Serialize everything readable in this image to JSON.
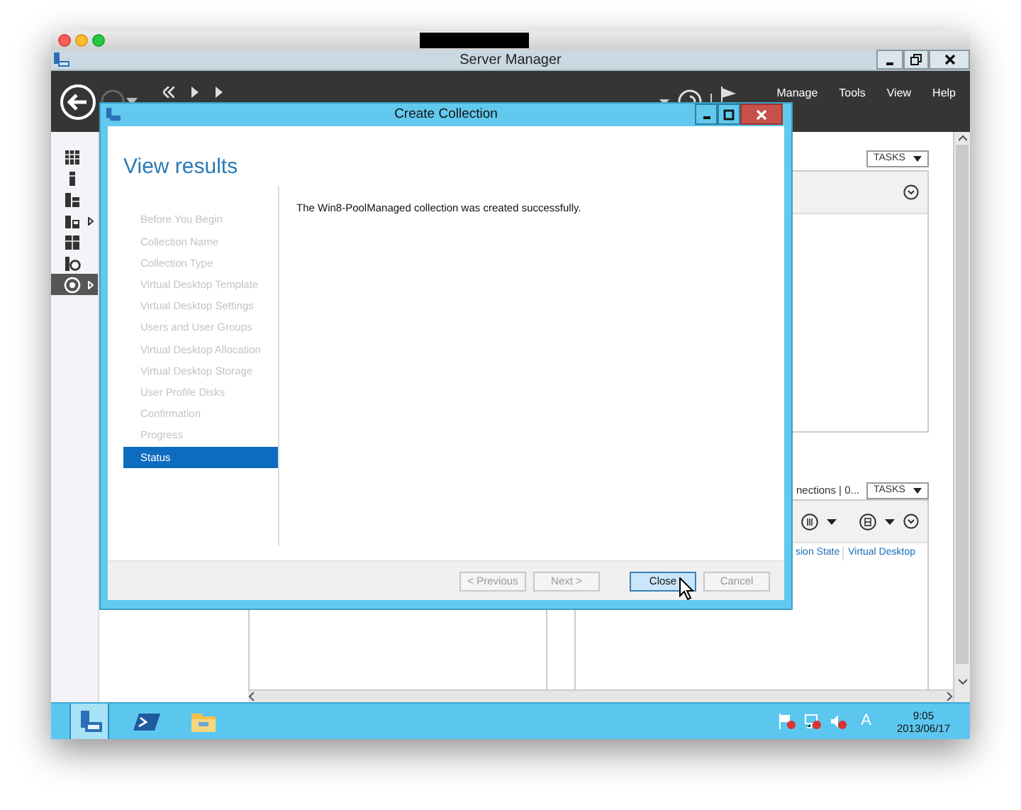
{
  "server_manager": {
    "title": "Server Manager",
    "menu": [
      "Manage",
      "Tools",
      "View",
      "Help"
    ],
    "nav": [
      {
        "kind": "dashboard",
        "expandable": false,
        "selected": false
      },
      {
        "kind": "server",
        "expandable": false,
        "selected": false
      },
      {
        "kind": "servers",
        "expandable": false,
        "selected": false
      },
      {
        "kind": "storage",
        "expandable": true,
        "selected": false
      },
      {
        "kind": "building",
        "expandable": false,
        "selected": false
      },
      {
        "kind": "iis",
        "expandable": false,
        "selected": false
      },
      {
        "kind": "rds",
        "expandable": true,
        "selected": true
      }
    ],
    "upper_panel": {
      "tasks": "TASKS"
    },
    "lower_panel": {
      "header": "nections | 0...",
      "tasks": "TASKS",
      "columns": [
        "sion State",
        "Virtual Desktop"
      ]
    }
  },
  "dialog": {
    "title": "Create Collection",
    "heading": "View results",
    "steps": [
      {
        "label": "Before You Begin",
        "selected": false
      },
      {
        "label": "Collection Name",
        "selected": false
      },
      {
        "label": "Collection Type",
        "selected": false
      },
      {
        "label": "Virtual Desktop Template",
        "selected": false
      },
      {
        "label": "Virtual Desktop Settings",
        "selected": false
      },
      {
        "label": "Users and User Groups",
        "selected": false
      },
      {
        "label": "Virtual Desktop Allocation",
        "selected": false
      },
      {
        "label": "Virtual Desktop Storage",
        "selected": false
      },
      {
        "label": "User Profile Disks",
        "selected": false
      },
      {
        "label": "Confirmation",
        "selected": false
      },
      {
        "label": "Progress",
        "selected": false
      },
      {
        "label": "Status",
        "selected": true
      }
    ],
    "message": "The Win8-PoolManaged collection was created successfully.",
    "buttons": [
      {
        "label": "< Previous",
        "disabled": true,
        "focused": false
      },
      {
        "label": "Next >",
        "disabled": true,
        "focused": false
      },
      {
        "label": "Close",
        "disabled": false,
        "focused": true
      },
      {
        "label": "Cancel",
        "disabled": true,
        "focused": false
      }
    ]
  },
  "taskbar": {
    "apps": [
      {
        "kind": "server-manager",
        "active": true
      },
      {
        "kind": "powershell",
        "active": false
      },
      {
        "kind": "explorer",
        "active": false
      }
    ],
    "input_indicator": "A",
    "time": "9:05",
    "date": "2013/06/17"
  }
}
